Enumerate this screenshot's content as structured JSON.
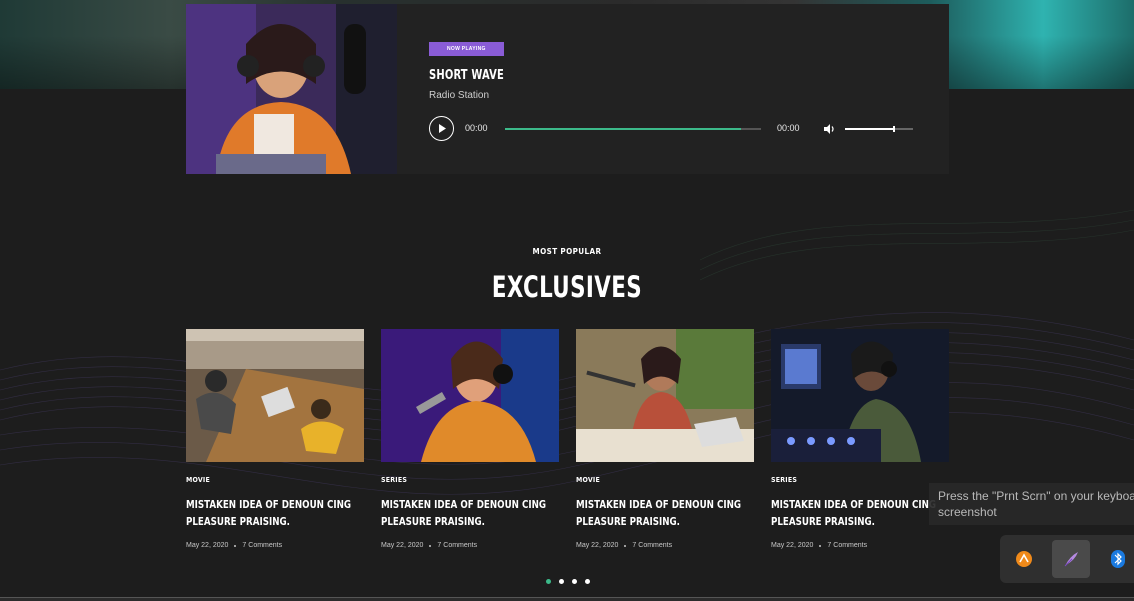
{
  "player": {
    "badge": "NOW PLAYING",
    "title": "SHORT WAVE",
    "subtitle": "Radio Station",
    "time_current": "00:00",
    "time_total": "00:00",
    "progress": 0.92,
    "volume": 0.7
  },
  "section": {
    "kicker": "MOST POPULAR",
    "title": "EXCLUSIVES"
  },
  "cards": [
    {
      "category": "MOVIE",
      "title": "MISTAKEN IDEA OF DENOUN CING PLEASURE PRAISING.",
      "date": "May 22, 2020",
      "comments": "7 Comments"
    },
    {
      "category": "SERIES",
      "title": "MISTAKEN IDEA OF DENOUN CING PLEASURE PRAISING.",
      "date": "May 22, 2020",
      "comments": "7 Comments"
    },
    {
      "category": "MOVIE",
      "title": "MISTAKEN IDEA OF DENOUN CING PLEASURE PRAISING.",
      "date": "May 22, 2020",
      "comments": "7 Comments"
    },
    {
      "category": "SERIES",
      "title": "MISTAKEN IDEA OF DENOUN CING PLEASURE PRAISING.",
      "date": "May 22, 2020",
      "comments": "7 Comments"
    }
  ],
  "pager": {
    "count": 4,
    "active": 0
  },
  "overlay": {
    "toast_text": "Press the \"Prnt Scrn\" on your keyboa\nscreenshot",
    "tray_icons": [
      "app-orange-icon",
      "feather-pen-icon",
      "bluetooth-icon"
    ]
  },
  "colors": {
    "accent_green": "#3cba8a",
    "badge_purple": "#8a5cd6",
    "background": "#1d1d1d"
  }
}
